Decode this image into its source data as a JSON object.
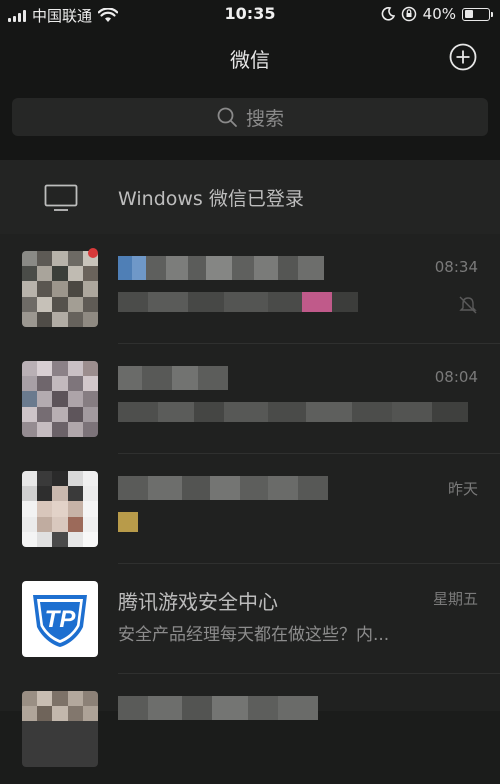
{
  "status_bar": {
    "carrier": "中国联通",
    "time": "10:35",
    "battery_text": "40%",
    "battery_level": 0.4,
    "icons": [
      "signal-icon",
      "wifi-icon",
      "moon-icon",
      "orientation-lock-icon",
      "battery-icon"
    ]
  },
  "nav": {
    "title": "微信",
    "add_icon": "plus-circle-icon"
  },
  "search": {
    "placeholder": "搜索",
    "icon": "search-icon"
  },
  "login_banner": {
    "text": "Windows 微信已登录",
    "icon": "monitor-icon"
  },
  "chats": [
    {
      "name": "",
      "preview": "",
      "time": "08:34",
      "blurred": true,
      "unread": true
    },
    {
      "name": "",
      "preview": "",
      "time": "08:04",
      "blurred": true,
      "unread": false
    },
    {
      "name": "",
      "preview": "",
      "time": "昨天",
      "blurred": true,
      "unread": false
    },
    {
      "name": "腾讯游戏安全中心",
      "preview": "安全产品经理每天都在做这些？内...",
      "time": "星期五",
      "blurred": false,
      "unread": false
    }
  ],
  "colors": {
    "background": "#1b1c1b",
    "chat_bg": "#202120",
    "tp_blue": "#1d6fd0"
  }
}
